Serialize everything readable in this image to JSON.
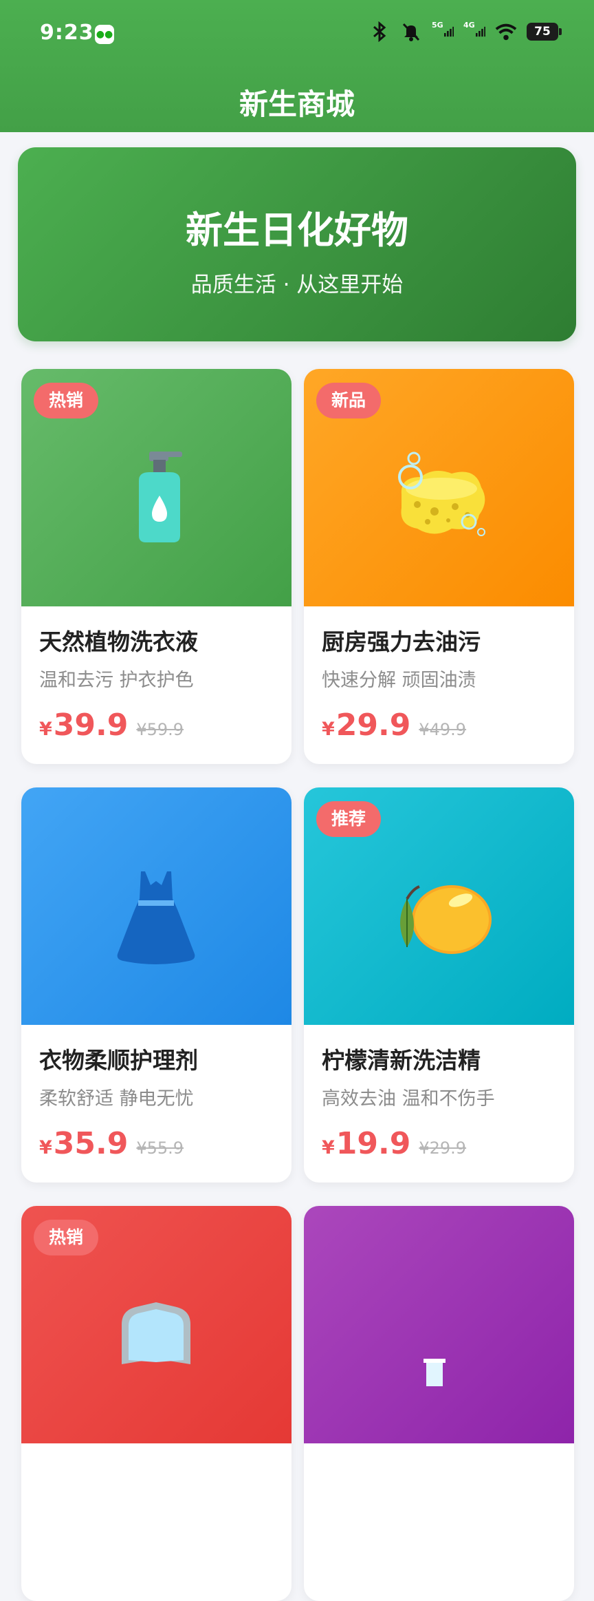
{
  "status_bar": {
    "time": "9:23",
    "network_5g": "5G",
    "network_4g": "4G",
    "battery": "75"
  },
  "header": {
    "title": "新生商城"
  },
  "banner": {
    "title": "新生日化好物",
    "subtitle": "品质生活 · 从这里开始"
  },
  "products": [
    {
      "badge": "热销",
      "name": "天然植物洗衣液",
      "desc": "温和去污 护衣护色",
      "currency": "¥",
      "price": "39.9",
      "old_price": "¥59.9",
      "icon": "detergent-bottle-icon",
      "colors": [
        "#66BB6A",
        "#43A047"
      ]
    },
    {
      "badge": "新品",
      "name": "厨房强力去油污",
      "desc": "快速分解 顽固油渍",
      "currency": "¥",
      "price": "29.9",
      "old_price": "¥49.9",
      "icon": "sponge-icon",
      "colors": [
        "#FFA726",
        "#FB8C00"
      ]
    },
    {
      "badge": "",
      "name": "衣物柔顺护理剂",
      "desc": "柔软舒适 静电无忧",
      "currency": "¥",
      "price": "35.9",
      "old_price": "¥55.9",
      "icon": "dress-icon",
      "colors": [
        "#42A5F5",
        "#1E88E5"
      ]
    },
    {
      "badge": "推荐",
      "name": "柠檬清新洗洁精",
      "desc": "高效去油 温和不伤手",
      "currency": "¥",
      "price": "19.9",
      "old_price": "¥29.9",
      "icon": "lemon-icon",
      "colors": [
        "#26C6DA",
        "#00ACC1"
      ]
    },
    {
      "badge": "热销",
      "name": "",
      "desc": "",
      "currency": "",
      "price": "",
      "old_price": "",
      "icon": "shield-icon",
      "colors": [
        "#EF5350",
        "#E53935"
      ]
    },
    {
      "badge": "",
      "name": "",
      "desc": "",
      "currency": "",
      "price": "",
      "old_price": "",
      "icon": "toothpaste-icon",
      "colors": [
        "#AB47BC",
        "#8E24AA"
      ]
    }
  ]
}
